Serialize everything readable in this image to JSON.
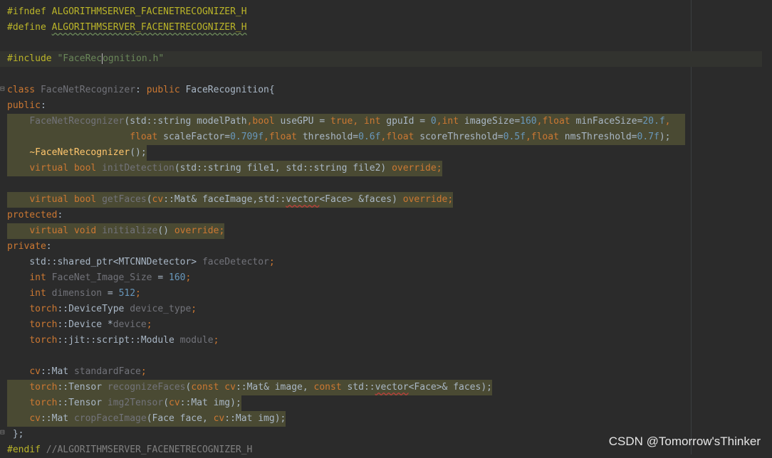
{
  "editor": {
    "colors": {
      "background": "#2b2b2b",
      "plain": "#a9b7c6",
      "keyword": "#cc7832",
      "type": "#a9b7c6",
      "number": "#6897bb",
      "string": "#6a8759",
      "macro": "#bbb529",
      "comment": "#808080",
      "member": "#9876aa",
      "unused": "#72737a",
      "function": "#ffc66d",
      "namespace": "#b5b6e3"
    },
    "lines": [
      {
        "hl": "none",
        "tokens": [
          {
            "t": "#ifndef ",
            "c": "macro"
          },
          {
            "t": "ALGORITHMSERVER_FACENETRECOGNIZER_H",
            "c": "macro"
          }
        ]
      },
      {
        "hl": "none",
        "tokens": [
          {
            "t": "#define ",
            "c": "macro"
          },
          {
            "t": "ALGORITHMSERVER_FACENETRECOGNIZER_H",
            "c": "macro",
            "wave": "green"
          }
        ]
      },
      {
        "hl": "none",
        "tokens": []
      },
      {
        "hl": "include",
        "tokens": [
          {
            "t": "#include ",
            "c": "macro"
          },
          {
            "t": "\"",
            "c": "string"
          },
          {
            "t": "FaceRec",
            "c": "string"
          },
          {
            "caret": true
          },
          {
            "t": "ognition.h",
            "c": "string"
          },
          {
            "t": "\"",
            "c": "string"
          }
        ]
      },
      {
        "hl": "none",
        "tokens": []
      },
      {
        "hl": "none",
        "tokens": [
          {
            "t": "class ",
            "c": "keyword"
          },
          {
            "t": "FaceNetRecognizer",
            "c": "unused"
          },
          {
            "t": ": ",
            "c": "plain"
          },
          {
            "t": "public ",
            "c": "keyword"
          },
          {
            "t": "FaceRecognition",
            "c": "type"
          },
          {
            "t": "{",
            "c": "plain"
          }
        ]
      },
      {
        "hl": "none",
        "tokens": [
          {
            "t": "public",
            "c": "keyword"
          },
          {
            "t": ":",
            "c": "plain"
          }
        ]
      },
      {
        "hl": "wide",
        "tokens": [
          {
            "t": "    ",
            "c": "plain"
          },
          {
            "t": "FaceNetRecognizer",
            "c": "unused"
          },
          {
            "t": "(",
            "c": "plain"
          },
          {
            "t": "std::string modelPath",
            "c": "plain"
          },
          {
            "t": ",",
            "c": "keyword"
          },
          {
            "t": "bool ",
            "c": "keyword"
          },
          {
            "t": "useGPU = ",
            "c": "plain"
          },
          {
            "t": "true",
            "c": "keyword"
          },
          {
            "t": ", ",
            "c": "keyword"
          },
          {
            "t": "int ",
            "c": "keyword"
          },
          {
            "t": "gpuId = ",
            "c": "plain"
          },
          {
            "t": "0",
            "c": "number"
          },
          {
            "t": ",",
            "c": "keyword"
          },
          {
            "t": "int ",
            "c": "keyword"
          },
          {
            "t": "imageSize=",
            "c": "plain"
          },
          {
            "t": "160",
            "c": "number"
          },
          {
            "t": ",",
            "c": "keyword"
          },
          {
            "t": "float ",
            "c": "keyword"
          },
          {
            "t": "minFaceSize=",
            "c": "plain"
          },
          {
            "t": "20.f",
            "c": "number"
          },
          {
            "t": ",",
            "c": "keyword"
          }
        ]
      },
      {
        "hl": "wide",
        "tokens": [
          {
            "t": "                      ",
            "c": "plain"
          },
          {
            "t": "float ",
            "c": "keyword"
          },
          {
            "t": "scaleFactor=",
            "c": "plain"
          },
          {
            "t": "0.709f",
            "c": "number"
          },
          {
            "t": ",",
            "c": "keyword"
          },
          {
            "t": "float ",
            "c": "keyword"
          },
          {
            "t": "threshold=",
            "c": "plain"
          },
          {
            "t": "0.6f",
            "c": "number"
          },
          {
            "t": ",",
            "c": "keyword"
          },
          {
            "t": "float ",
            "c": "keyword"
          },
          {
            "t": "scoreThreshold=",
            "c": "plain"
          },
          {
            "t": "0.5f",
            "c": "number"
          },
          {
            "t": ",",
            "c": "keyword"
          },
          {
            "t": "float ",
            "c": "keyword"
          },
          {
            "t": "nmsThreshold=",
            "c": "plain"
          },
          {
            "t": "0.7f",
            "c": "number"
          },
          {
            "t": ");",
            "c": "plain"
          }
        ]
      },
      {
        "hl": "part",
        "tokens": [
          {
            "t": "    ",
            "c": "plain"
          },
          {
            "t": "~FaceNetRecognizer",
            "c": "function"
          },
          {
            "t": "();",
            "c": "plain"
          }
        ]
      },
      {
        "hl": "part",
        "tokens": [
          {
            "t": "    ",
            "c": "plain"
          },
          {
            "t": "virtual ",
            "c": "keyword"
          },
          {
            "t": "bool ",
            "c": "keyword"
          },
          {
            "t": "initDetection",
            "c": "unused"
          },
          {
            "t": "(std::string file1, std::string file2) ",
            "c": "plain"
          },
          {
            "t": "override",
            "c": "keyword"
          },
          {
            "t": ";",
            "c": "keyword"
          }
        ]
      },
      {
        "hl": "none",
        "tokens": []
      },
      {
        "hl": "part",
        "tokens": [
          {
            "t": "    ",
            "c": "plain"
          },
          {
            "t": "virtual ",
            "c": "keyword"
          },
          {
            "t": "bool ",
            "c": "keyword"
          },
          {
            "t": "getFaces",
            "c": "unused"
          },
          {
            "t": "(",
            "c": "plain"
          },
          {
            "t": "cv",
            "c": "keyword"
          },
          {
            "t": "::Mat& faceImage,std::",
            "c": "plain"
          },
          {
            "t": "vector",
            "c": "plain",
            "wave": "red"
          },
          {
            "t": "<Face> &faces) ",
            "c": "plain"
          },
          {
            "t": "override",
            "c": "keyword"
          },
          {
            "t": ";",
            "c": "keyword"
          }
        ]
      },
      {
        "hl": "none",
        "tokens": [
          {
            "t": "protected",
            "c": "keyword"
          },
          {
            "t": ":",
            "c": "plain"
          }
        ]
      },
      {
        "hl": "part",
        "tokens": [
          {
            "t": "    ",
            "c": "plain"
          },
          {
            "t": "virtual ",
            "c": "keyword"
          },
          {
            "t": "void ",
            "c": "keyword"
          },
          {
            "t": "initialize",
            "c": "unused"
          },
          {
            "t": "() ",
            "c": "plain"
          },
          {
            "t": "override",
            "c": "keyword"
          },
          {
            "t": ";",
            "c": "keyword"
          }
        ]
      },
      {
        "hl": "none",
        "tokens": [
          {
            "t": "private",
            "c": "keyword"
          },
          {
            "t": ":",
            "c": "plain"
          }
        ]
      },
      {
        "hl": "none",
        "tokens": [
          {
            "t": "    ",
            "c": "plain"
          },
          {
            "t": "std::shared_ptr<MTCNNDetector> ",
            "c": "plain"
          },
          {
            "t": "faceDetector",
            "c": "unused"
          },
          {
            "t": ";",
            "c": "keyword"
          }
        ]
      },
      {
        "hl": "none",
        "tokens": [
          {
            "t": "    ",
            "c": "plain"
          },
          {
            "t": "int ",
            "c": "keyword"
          },
          {
            "t": "FaceNet_Image_Size",
            "c": "unused"
          },
          {
            "t": " = ",
            "c": "plain"
          },
          {
            "t": "160",
            "c": "number"
          },
          {
            "t": ";",
            "c": "keyword"
          }
        ]
      },
      {
        "hl": "none",
        "tokens": [
          {
            "t": "    ",
            "c": "plain"
          },
          {
            "t": "int ",
            "c": "keyword"
          },
          {
            "t": "dimension",
            "c": "unused"
          },
          {
            "t": " = ",
            "c": "plain"
          },
          {
            "t": "512",
            "c": "number"
          },
          {
            "t": ";",
            "c": "keyword"
          }
        ]
      },
      {
        "hl": "none",
        "tokens": [
          {
            "t": "    ",
            "c": "plain"
          },
          {
            "t": "torch",
            "c": "keyword"
          },
          {
            "t": "::DeviceType ",
            "c": "plain"
          },
          {
            "t": "device_type",
            "c": "unused"
          },
          {
            "t": ";",
            "c": "keyword"
          }
        ]
      },
      {
        "hl": "none",
        "tokens": [
          {
            "t": "    ",
            "c": "plain"
          },
          {
            "t": "torch",
            "c": "keyword"
          },
          {
            "t": "::Device *",
            "c": "plain"
          },
          {
            "t": "device",
            "c": "unused"
          },
          {
            "t": ";",
            "c": "keyword"
          }
        ]
      },
      {
        "hl": "none",
        "tokens": [
          {
            "t": "    ",
            "c": "plain"
          },
          {
            "t": "torch",
            "c": "keyword"
          },
          {
            "t": "::jit::script::Module ",
            "c": "plain"
          },
          {
            "t": "module",
            "c": "unused"
          },
          {
            "t": ";",
            "c": "keyword"
          }
        ]
      },
      {
        "hl": "none",
        "tokens": []
      },
      {
        "hl": "none",
        "tokens": [
          {
            "t": "    ",
            "c": "plain"
          },
          {
            "t": "cv",
            "c": "keyword"
          },
          {
            "t": "::Mat ",
            "c": "plain"
          },
          {
            "t": "standardFace",
            "c": "unused"
          },
          {
            "t": ";",
            "c": "keyword"
          }
        ]
      },
      {
        "hl": "part",
        "tokens": [
          {
            "t": "    ",
            "c": "plain"
          },
          {
            "t": "torch",
            "c": "keyword"
          },
          {
            "t": "::Tensor ",
            "c": "plain"
          },
          {
            "t": "recognizeFaces",
            "c": "unused"
          },
          {
            "t": "(",
            "c": "plain"
          },
          {
            "t": "const ",
            "c": "keyword"
          },
          {
            "t": "cv",
            "c": "keyword"
          },
          {
            "t": "::Mat& image, ",
            "c": "plain"
          },
          {
            "t": "const ",
            "c": "keyword"
          },
          {
            "t": "std::",
            "c": "plain"
          },
          {
            "t": "vector",
            "c": "plain",
            "wave": "red"
          },
          {
            "t": "<Face>& faces);",
            "c": "plain"
          }
        ]
      },
      {
        "hl": "part",
        "tokens": [
          {
            "t": "    ",
            "c": "plain"
          },
          {
            "t": "torch",
            "c": "keyword"
          },
          {
            "t": "::Tensor ",
            "c": "plain"
          },
          {
            "t": "img2Tensor",
            "c": "unused"
          },
          {
            "t": "(",
            "c": "plain"
          },
          {
            "t": "cv",
            "c": "keyword"
          },
          {
            "t": "::Mat img);",
            "c": "plain"
          }
        ]
      },
      {
        "hl": "part",
        "tokens": [
          {
            "t": "    ",
            "c": "plain"
          },
          {
            "t": "cv",
            "c": "keyword"
          },
          {
            "t": "::Mat ",
            "c": "plain"
          },
          {
            "t": "cropFaceImage",
            "c": "unused"
          },
          {
            "t": "(Face face, ",
            "c": "plain"
          },
          {
            "t": "cv",
            "c": "keyword"
          },
          {
            "t": "::Mat img);",
            "c": "plain"
          }
        ]
      },
      {
        "hl": "none",
        "tokens": [
          {
            "t": " };",
            "c": "plain"
          }
        ]
      },
      {
        "hl": "none",
        "tokens": [
          {
            "t": "#endif ",
            "c": "macro"
          },
          {
            "t": "//ALGORITHMSERVER_FACENETRECOGNIZER_H",
            "c": "comment"
          }
        ]
      }
    ]
  },
  "watermark": "CSDN @Tomorrow'sThinker"
}
